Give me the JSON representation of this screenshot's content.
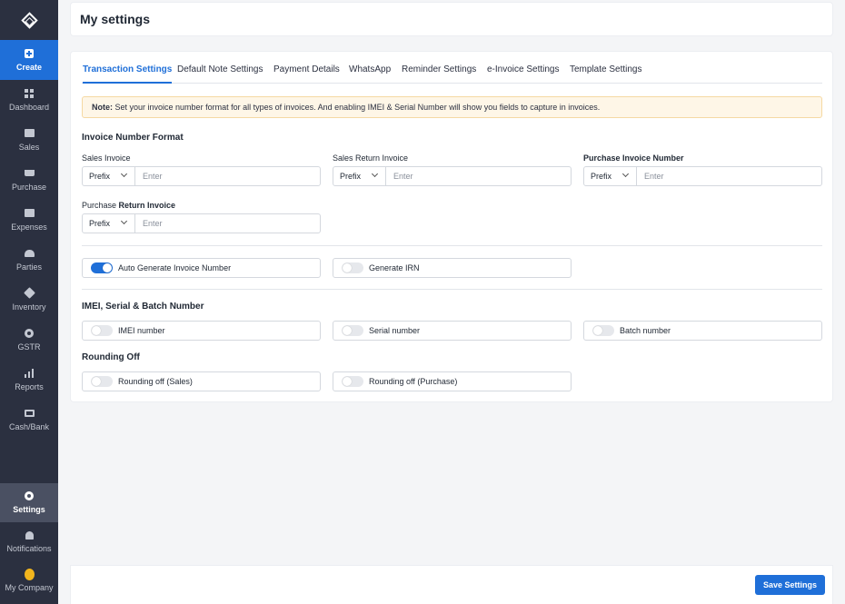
{
  "sidebar": {
    "create": {
      "label": "Create",
      "icon": "plus-icon"
    },
    "items": [
      {
        "label": "Dashboard",
        "icon": "grid-icon"
      },
      {
        "label": "Sales",
        "icon": "receipt-icon"
      },
      {
        "label": "Purchase",
        "icon": "cart-icon"
      },
      {
        "label": "Expenses",
        "icon": "wallet-icon"
      },
      {
        "label": "Parties",
        "icon": "people-icon"
      },
      {
        "label": "Inventory",
        "icon": "cube-icon"
      },
      {
        "label": "GSTR",
        "icon": "gstr-icon"
      },
      {
        "label": "Reports",
        "icon": "bar-chart-icon"
      },
      {
        "label": "Cash/Bank",
        "icon": "cash-icon"
      }
    ],
    "bottom": [
      {
        "label": "Settings",
        "icon": "gear-icon",
        "active": true
      },
      {
        "label": "Notifications",
        "icon": "bell-icon"
      },
      {
        "label": "My Company",
        "icon": "company-logo-icon"
      }
    ]
  },
  "header": {
    "title": "My settings"
  },
  "tabs": [
    {
      "label": "Transaction Settings",
      "active": true
    },
    {
      "label": "Default Note Settings"
    },
    {
      "label": "Payment Details"
    },
    {
      "label": "WhatsApp"
    },
    {
      "label": "Reminder Settings"
    },
    {
      "label": "e-Invoice Settings"
    },
    {
      "label": "Template Settings"
    }
  ],
  "note": {
    "prefix": "Note:",
    "text": "Set your invoice number format for all types of invoices. And enabling IMEI & Serial Number will show you fields to capture in invoices."
  },
  "invoice_format": {
    "title": "Invoice Number Format",
    "fields": [
      {
        "label": "Sales Invoice",
        "select": "Prefix",
        "placeholder": "Enter",
        "value": ""
      },
      {
        "label": "Sales Return Invoice",
        "select": "Prefix",
        "placeholder": "Enter",
        "value": ""
      },
      {
        "label": "Purchase Invoice Number",
        "select": "Prefix",
        "placeholder": "Enter",
        "value": ""
      },
      {
        "label_part1": "Purchase ",
        "label_part2": "Return Invoice",
        "select": "Prefix",
        "placeholder": "Enter",
        "value": ""
      }
    ]
  },
  "toggles_general": [
    {
      "label": "Auto Generate Invoice Number",
      "on": true
    },
    {
      "label": "Generate IRN",
      "on": false
    }
  ],
  "imei_section": {
    "title": "IMEI, Serial & Batch Number",
    "toggles": [
      {
        "label": "IMEI number",
        "on": false
      },
      {
        "label": "Serial number",
        "on": false
      },
      {
        "label": "Batch number",
        "on": false
      }
    ]
  },
  "rounding_section": {
    "title": "Rounding Off",
    "toggles": [
      {
        "label": "Rounding off (Sales)",
        "on": false
      },
      {
        "label": "Rounding off (Purchase)",
        "on": false
      }
    ]
  },
  "footer": {
    "save_label": "Save Settings"
  },
  "colors": {
    "accent": "#1f6fd8",
    "sidebar": "#2b3040",
    "note_bg": "#fef6e7"
  }
}
